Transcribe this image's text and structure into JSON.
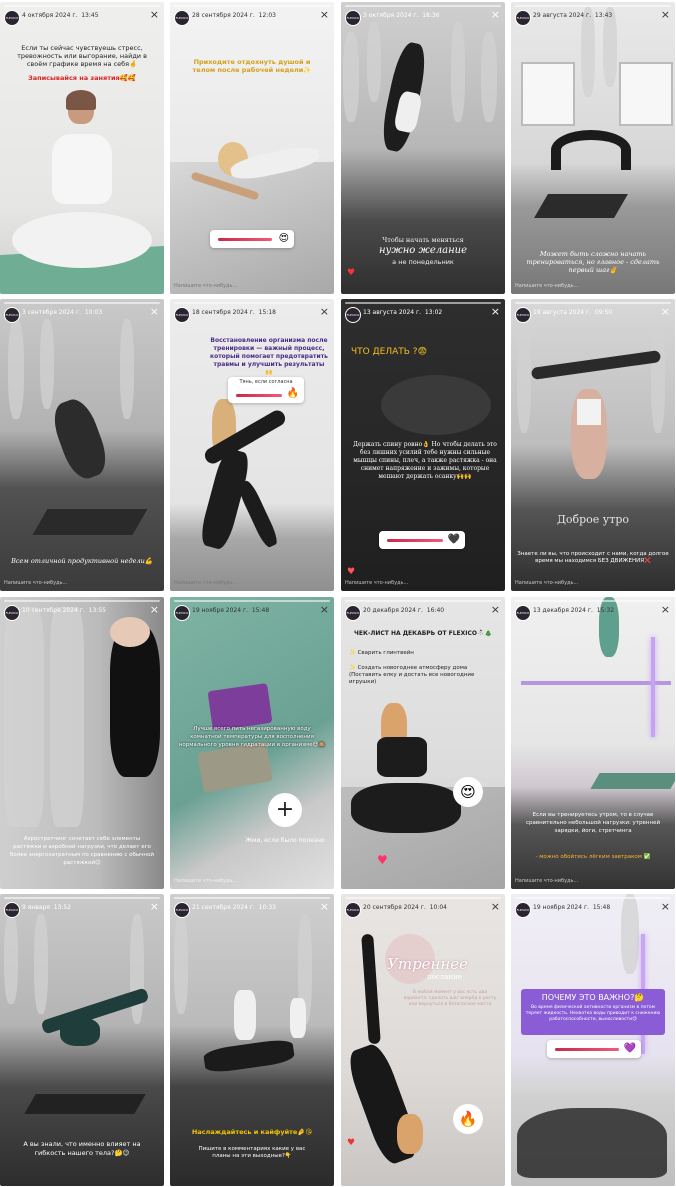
{
  "brand_avatar": "FLEXICO",
  "reply_placeholder": "Напишите что-нибудь...",
  "close_icon": "×",
  "stories": [
    {
      "date": "4 октября 2024 г.",
      "time": "13:45",
      "caption": "Если ты сейчас чувствуешь стресс, тревожность или выгорание, найди в своём графике время на себя🤞",
      "cta": "Записывайся на занятия🥰🥰"
    },
    {
      "date": "28 сентября 2024 г.",
      "time": "12:03",
      "caption": "Приходите отдохнуть душой и телом после рабочей недели✨",
      "slider_emoji": "😍"
    },
    {
      "date": "3 октября 2024 г.",
      "time": "18:36",
      "caption1": "Чтобы начать меняться",
      "caption2": "нужно желание",
      "caption3": "а не понедельник"
    },
    {
      "date": "29 августа 2024 г.",
      "time": "13:43",
      "caption": "Может быть сложно начать тренироваться, но главное - сделать первый шаг✌"
    },
    {
      "date": "3 сентября 2024 г.",
      "time": "10:03",
      "caption": "Всем отличной продуктивной недели💪"
    },
    {
      "date": "18 сентября 2024 г.",
      "time": "15:18",
      "caption": "Восстановление организма после тренировки — важный процесс, который помогает предотвратить травмы и улучшить результаты🙌",
      "slider_label": "Тянь, если согласна",
      "slider_emoji": "🔥"
    },
    {
      "date": "13 августа 2024 г.",
      "time": "13:02",
      "title": "ЧТО ДЕЛАТЬ ?😨",
      "caption": "Держать спину ровно👌 Но чтобы делать это без лишних усилий тебе нужны сильные мышцы спины, плеч, а также растяжка - она снимет напряжение и зажимы, которые мешают держать осанку🙌🙌",
      "slider_emoji": "🖤"
    },
    {
      "date": "19 августа 2024 г.",
      "time": "09:50",
      "overlay": "Доброе утро",
      "caption": "Знаете ли вы, что происходит с нами, когда долгое время мы находимся БЕЗ ДВИЖЕНИЯ❌"
    },
    {
      "date": "10 сентября 2024 г.",
      "time": "13:55",
      "caption": "Аэростретчинг сочетает себе элементы растяжки и аэробной нагрузки, что делает его более энергозатратным по сравнению с обычной растяжкой😉"
    },
    {
      "date": "19 ноября 2024 г.",
      "time": "15:48",
      "caption": "Лучше всего пить негазированную воду комнатной температуры для восполнения нормального уровня гидратации в организме😍🙈",
      "cta": "Жми, если было полезно",
      "bubble": "+"
    },
    {
      "date": "20 декабря 2024 г.",
      "time": "16:40",
      "title": "ЧЕК-ЛИСТ НА ДЕКАБРЬ ОТ FLEXICO⛄🎄",
      "item1": "✨ Сварить глинтвейн",
      "item2": "✨ Создать новогоднее атмосферу дома (Поставить елку и достать все новогодние игрушки)",
      "bubble": "😍"
    },
    {
      "date": "13 декабря 2024 г.",
      "time": "15:32",
      "caption": "Если вы тренируетесь утром, то в случае сравнительно небольшой нагрузки: утренней зарядки, йоги, стретчинга",
      "caption2": "- можно обойтись лёгким завтраком ✅"
    },
    {
      "date": "9 января",
      "time": "13:52",
      "caption": "А вы знали, что именно влияет на гибкость нашего тела?🤔😉"
    },
    {
      "date": "21 сентября 2024 г.",
      "time": "10:33",
      "caption": "Наслаждайтесь и кайфуйте🤌😘",
      "caption2": "Пишите в комментариях какие у вас планы на эти выходные?👇"
    },
    {
      "date": "20 сентября 2024 г.",
      "time": "10:04",
      "overlay1": "Утреннее",
      "overlay2": "послание",
      "caption": "В любой момент у вас есть два варианта: сделать шаг вперёд к росту или вернуться в безопасное место",
      "bubble": "🔥"
    },
    {
      "date": "19 ноября 2024 г.",
      "time": "15:48",
      "title": "ПОЧЕМУ ЭТО ВАЖНО?🤔",
      "caption": "Во время физической активности организм в потом теряет жидкость. Нехватка воды приводит к снижению работоспособности, выносливости😓",
      "slider_emoji": "💜"
    }
  ]
}
